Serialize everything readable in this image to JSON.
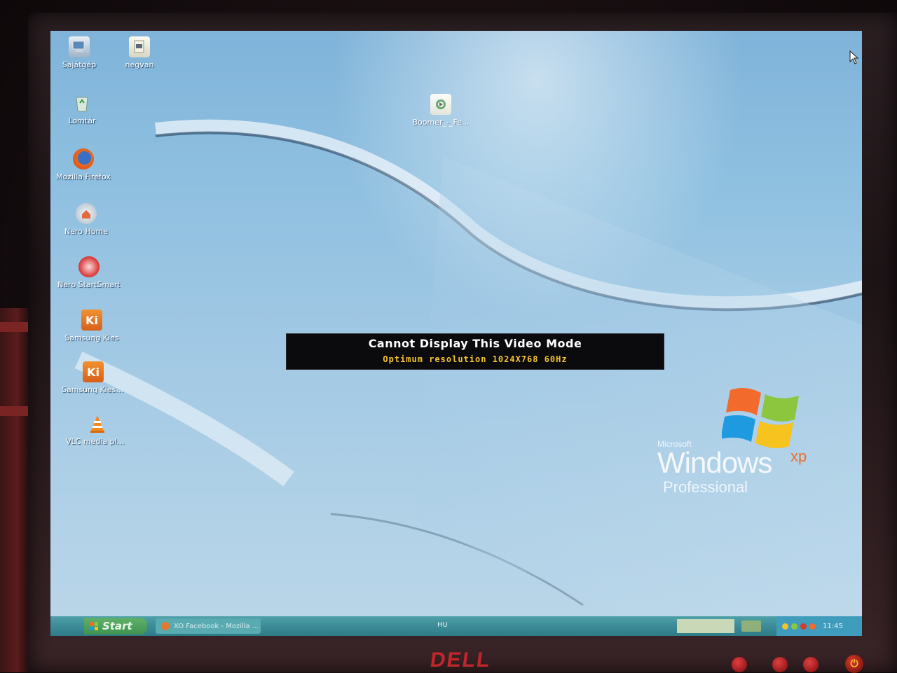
{
  "monitor": {
    "brand": "DELL",
    "power_icon": "power-icon"
  },
  "desktop": {
    "icons": [
      {
        "label": "Sajátgép",
        "icon": "my-computer-icon"
      },
      {
        "label": "negvan",
        "icon": "document-icon"
      },
      {
        "label": "Lomtár",
        "icon": "recycle-bin-icon"
      },
      {
        "label": "Mozilla Firefox",
        "icon": "firefox-icon"
      },
      {
        "label": "Nero Home",
        "icon": "nero-home-icon"
      },
      {
        "label": "Nero StartSmart",
        "icon": "nero-startsmart-icon"
      },
      {
        "label": "Samsung Kies",
        "icon": "samsung-kies-icon"
      },
      {
        "label": "Samsung Kies (Lite)",
        "icon": "samsung-kies-lite-icon"
      },
      {
        "label": "VLC media player",
        "icon": "vlc-icon"
      },
      {
        "label": "Boomer_-_Fe...",
        "icon": "media-file-icon"
      }
    ]
  },
  "osd": {
    "title": "Cannot Display This Video Mode",
    "resolution_label": "Optimum resolution  1024X768 60Hz"
  },
  "xp_logo": {
    "microsoft": "Microsoft",
    "windows": "Windows",
    "xp": "xp",
    "edition": "Professional"
  },
  "taskbar": {
    "start_label": "Start",
    "task_label": "XO Facebook - Mozilla ...",
    "language": "HU",
    "time": "11:45"
  },
  "colors": {
    "osd_bg": "#0b0b0d",
    "osd_title": "#ffffff",
    "osd_resolution": "#f2c230",
    "taskbar": "#3c8c98",
    "dell_logo": "#c0262a"
  }
}
